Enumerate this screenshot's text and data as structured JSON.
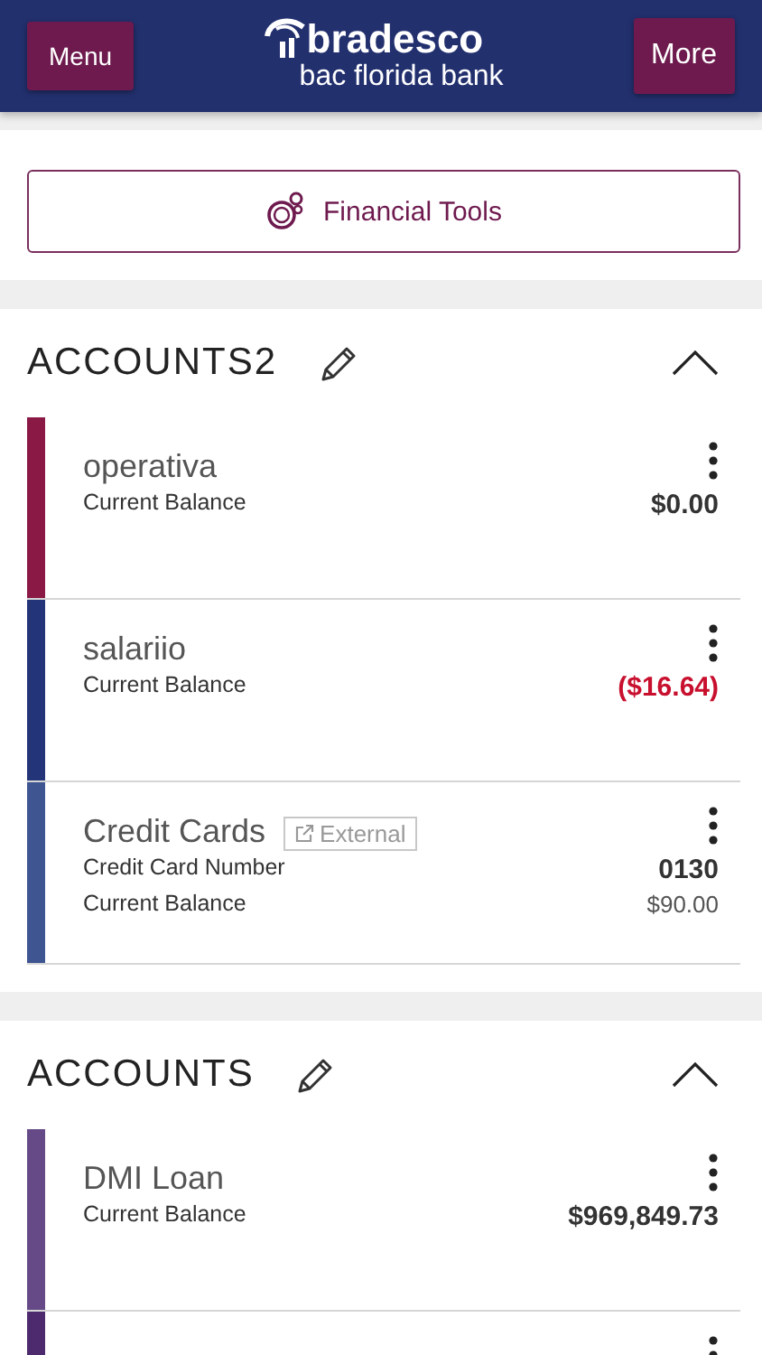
{
  "header": {
    "menu_button": "Menu",
    "logo_name": "bradesco",
    "logo_subtitle": "bac florida bank",
    "more_button": "More"
  },
  "tools_button": "Financial Tools",
  "sections": [
    {
      "title": "ACCOUNTS2",
      "expanded": true,
      "accounts": [
        {
          "kind": "account",
          "color": "#8a1a45",
          "name": "operativa",
          "lines": [
            {
              "label": "Current Balance",
              "value": "$0.00",
              "bold": true,
              "negative": false
            }
          ]
        },
        {
          "kind": "account",
          "color": "#243478",
          "name": "salariio",
          "lines": [
            {
              "label": "Current Balance",
              "value": "($16.64)",
              "bold": true,
              "negative": true
            }
          ]
        },
        {
          "kind": "account",
          "color": "#3f5592",
          "name": "Credit Cards",
          "badge": "External",
          "lines": [
            {
              "label": "Credit Card Number",
              "value": "0130",
              "bold": true,
              "negative": false
            },
            {
              "label": "Current Balance",
              "value": "$90.00",
              "bold": false,
              "negative": false
            }
          ]
        }
      ]
    },
    {
      "title": "ACCOUNTS",
      "expanded": true,
      "accounts": [
        {
          "kind": "account",
          "color": "#664a87",
          "name": "DMI Loan",
          "lines": [
            {
              "label": "Current Balance",
              "value": "$969,849.73",
              "bold": true,
              "negative": false
            }
          ]
        },
        {
          "kind": "partial",
          "color": "#4d2a6e"
        }
      ]
    }
  ]
}
